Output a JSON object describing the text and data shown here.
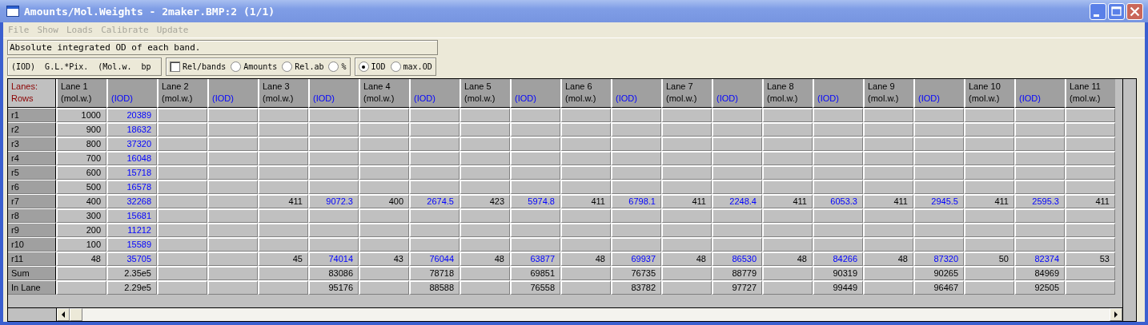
{
  "window": {
    "title": "Amounts/Mol.Weights - 2maker.BMP:2 (1/1)"
  },
  "menu": [
    {
      "label": "File",
      "disabled": true
    },
    {
      "label": "Show",
      "disabled": true
    },
    {
      "label": "Loads",
      "disabled": true
    },
    {
      "label": "Calibrate",
      "disabled": true
    },
    {
      "label": "Update",
      "disabled": true
    }
  ],
  "description": "Absolute integrated OD of each band.",
  "units": [
    "(IOD)",
    "G.L.*Pix.",
    "(Mol.w.",
    "bp"
  ],
  "options": [
    {
      "kind": "checkbox",
      "label": "Rel/bands",
      "checked": false
    },
    {
      "kind": "radio",
      "label": "Amounts",
      "selected": false
    },
    {
      "kind": "radio",
      "label": "Rel.ab",
      "selected": false
    },
    {
      "kind": "radio",
      "label": "%",
      "selected": false
    }
  ],
  "measure": [
    {
      "label": "IOD",
      "selected": true
    },
    {
      "label": "max.OD",
      "selected": false
    }
  ],
  "table": {
    "corner": [
      "Lanes:",
      "Rows"
    ],
    "columns": [
      {
        "kind": "molw",
        "title": "Lane 1",
        "subtitle": "(mol.w.)"
      },
      {
        "kind": "iod",
        "title": "(IOD)"
      },
      {
        "kind": "molw",
        "title": "Lane 2",
        "subtitle": "(mol.w.)"
      },
      {
        "kind": "iod",
        "title": "(IOD)"
      },
      {
        "kind": "molw",
        "title": "Lane 3",
        "subtitle": "(mol.w.)"
      },
      {
        "kind": "iod",
        "title": "(IOD)"
      },
      {
        "kind": "molw",
        "title": "Lane 4",
        "subtitle": "(mol.w.)"
      },
      {
        "kind": "iod",
        "title": "(IOD)"
      },
      {
        "kind": "molw",
        "title": "Lane 5",
        "subtitle": "(mol.w.)"
      },
      {
        "kind": "iod",
        "title": "(IOD)"
      },
      {
        "kind": "molw",
        "title": "Lane 6",
        "subtitle": "(mol.w.)"
      },
      {
        "kind": "iod",
        "title": "(IOD)"
      },
      {
        "kind": "molw",
        "title": "Lane 7",
        "subtitle": "(mol.w.)"
      },
      {
        "kind": "iod",
        "title": "(IOD)"
      },
      {
        "kind": "molw",
        "title": "Lane 8",
        "subtitle": "(mol.w.)"
      },
      {
        "kind": "iod",
        "title": "(IOD)"
      },
      {
        "kind": "molw",
        "title": "Lane 9",
        "subtitle": "(mol.w.)"
      },
      {
        "kind": "iod",
        "title": "(IOD)"
      },
      {
        "kind": "molw",
        "title": "Lane 10",
        "subtitle": "(mol.w.)"
      },
      {
        "kind": "iod",
        "title": "(IOD)"
      },
      {
        "kind": "molw",
        "title": "Lane 11",
        "subtitle": "(mol.w.)"
      }
    ],
    "rows": [
      {
        "kind": "band",
        "label": "r1",
        "cells": [
          "1000",
          "20389",
          null,
          null,
          null,
          null,
          null,
          null,
          null,
          null,
          null,
          null,
          null,
          null,
          null,
          null,
          null,
          null,
          null,
          null,
          null
        ]
      },
      {
        "kind": "band",
        "label": "r2",
        "cells": [
          "900",
          "18632",
          null,
          null,
          null,
          null,
          null,
          null,
          null,
          null,
          null,
          null,
          null,
          null,
          null,
          null,
          null,
          null,
          null,
          null,
          null
        ]
      },
      {
        "kind": "band",
        "label": "r3",
        "cells": [
          "800",
          "37320",
          null,
          null,
          null,
          null,
          null,
          null,
          null,
          null,
          null,
          null,
          null,
          null,
          null,
          null,
          null,
          null,
          null,
          null,
          null
        ]
      },
      {
        "kind": "band",
        "label": "r4",
        "cells": [
          "700",
          "16048",
          null,
          null,
          null,
          null,
          null,
          null,
          null,
          null,
          null,
          null,
          null,
          null,
          null,
          null,
          null,
          null,
          null,
          null,
          null
        ]
      },
      {
        "kind": "band",
        "label": "r5",
        "cells": [
          "600",
          "15718",
          null,
          null,
          null,
          null,
          null,
          null,
          null,
          null,
          null,
          null,
          null,
          null,
          null,
          null,
          null,
          null,
          null,
          null,
          null
        ]
      },
      {
        "kind": "band",
        "label": "r6",
        "cells": [
          "500",
          "16578",
          null,
          null,
          null,
          null,
          null,
          null,
          null,
          null,
          null,
          null,
          null,
          null,
          null,
          null,
          null,
          null,
          null,
          null,
          null
        ]
      },
      {
        "kind": "band",
        "label": "r7",
        "cells": [
          "400",
          "32268",
          null,
          null,
          "411",
          "9072.3",
          "400",
          "2674.5",
          "423",
          "5974.8",
          "411",
          "6798.1",
          "411",
          "2248.4",
          "411",
          "6053.3",
          "411",
          "2945.5",
          "411",
          "2595.3",
          "411"
        ]
      },
      {
        "kind": "band",
        "label": "r8",
        "cells": [
          "300",
          "15681",
          null,
          null,
          null,
          null,
          null,
          null,
          null,
          null,
          null,
          null,
          null,
          null,
          null,
          null,
          null,
          null,
          null,
          null,
          null
        ]
      },
      {
        "kind": "band",
        "label": "r9",
        "cells": [
          "200",
          "11212",
          null,
          null,
          null,
          null,
          null,
          null,
          null,
          null,
          null,
          null,
          null,
          null,
          null,
          null,
          null,
          null,
          null,
          null,
          null
        ]
      },
      {
        "kind": "band",
        "label": "r10",
        "cells": [
          "100",
          "15589",
          null,
          null,
          null,
          null,
          null,
          null,
          null,
          null,
          null,
          null,
          null,
          null,
          null,
          null,
          null,
          null,
          null,
          null,
          null
        ]
      },
      {
        "kind": "band",
        "label": "r11",
        "cells": [
          "48",
          "35705",
          null,
          null,
          "45",
          "74014",
          "43",
          "76044",
          "48",
          "63877",
          "48",
          "69937",
          "48",
          "86530",
          "48",
          "84266",
          "48",
          "87320",
          "50",
          "82374",
          "53"
        ]
      },
      {
        "kind": "total",
        "label": "Sum",
        "cells": [
          null,
          "2.35e5",
          null,
          null,
          null,
          "83086",
          null,
          "78718",
          null,
          "69851",
          null,
          "76735",
          null,
          "88779",
          null,
          "90319",
          null,
          "90265",
          null,
          "84969",
          null
        ]
      },
      {
        "kind": "total",
        "label": "In Lane",
        "cells": [
          null,
          "2.29e5",
          null,
          null,
          null,
          "95176",
          null,
          "88588",
          null,
          "76558",
          null,
          "83782",
          null,
          "97727",
          null,
          "99449",
          null,
          "96467",
          null,
          "92505",
          null
        ]
      }
    ]
  }
}
